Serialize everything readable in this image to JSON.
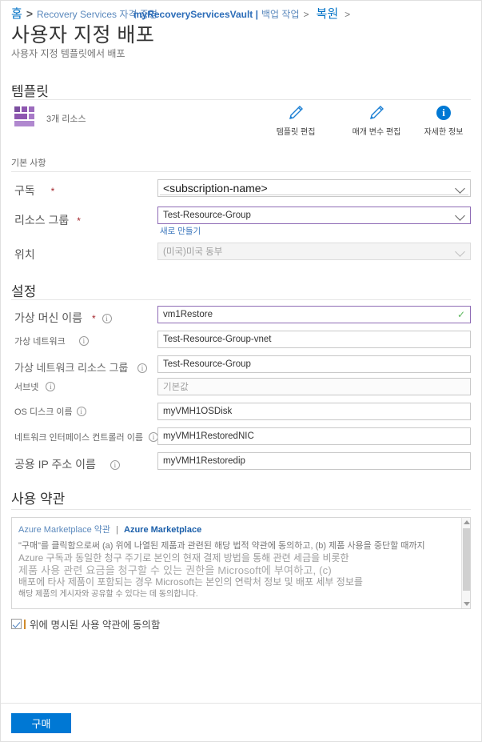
{
  "breadcrumb": {
    "home": "홈",
    "sep": ">",
    "vault_prefix": "Recovery Services 자격 증명",
    "vault_name": "myRecoveryServicesVault |",
    "backup_jobs": "백업 작업",
    "restore": "복원"
  },
  "header": {
    "title": "사용자 지정 배포",
    "subtitle": "사용자 지정 템플릿에서 배포"
  },
  "template": {
    "heading": "템플릿",
    "resource_count": "3개 리소스",
    "actions": [
      {
        "label": "템플릿 편집",
        "icon": "pencil-icon"
      },
      {
        "label": "매개 변수 편집",
        "icon": "pencil-icon"
      },
      {
        "label": "자세한 정보",
        "icon": "info-icon"
      }
    ]
  },
  "basics": {
    "heading": "기본 사항",
    "subscription": {
      "label": "구독",
      "required": "*",
      "value": "<subscription-name>"
    },
    "resource_group": {
      "label": "리소스 그룹",
      "required": "*",
      "value": "Test-Resource-Group",
      "create_new": "새로 만들기"
    },
    "location": {
      "label": "위치",
      "value": "(미국)미국 동부"
    }
  },
  "settings": {
    "heading": "설정",
    "fields": [
      {
        "label": "가상 머신 이름",
        "required": "*",
        "value": "vm1Restore"
      },
      {
        "label": "가상 네트워크",
        "value": "Test-Resource-Group-vnet"
      },
      {
        "label": "가상 네트워크 리소스 그룹",
        "value": "Test-Resource-Group"
      },
      {
        "label": "서브넷",
        "placeholder": "기본값"
      },
      {
        "label": "OS 디스크 이름",
        "value": "myVMH1OSDisk"
      },
      {
        "label": "네트워크 인터페이스 컨트롤러 이름",
        "value": "myVMH1RestoredNIC"
      },
      {
        "label": "공용 IP 주소 이름",
        "value": "myVMH1Restoredip"
      }
    ]
  },
  "terms": {
    "heading": "사용 약관",
    "link_marketplace_terms": "Azure Marketplace 약관",
    "link_separator": "|",
    "link_marketplace": "Azure Marketplace",
    "body_lines": [
      "\"구매\"를 클릭함으로써 (a) 위에 나열된 제품과 관련된 해당 법적 약관에 동의하고, (b) 제품 사용을 중단할 때까지",
      "Azure 구독과 동일한 청구 주기로 본인의 현재 결제 방법을 통해 관련 세금을 비롯한",
      "제품 사용 관련 요금을 청구할 수 있는  권한을 Microsoft에 부여하고, (c)",
      "배포에 타사 제품이 포함되는 경우 Microsoft는 본인의 연락처 정보 및 배포 세부 정보를",
      "해당 제품의 게시자와 공유할 수 있다는 데 동의합니다."
    ],
    "agree_label": "위에 명시된 사용 약관에 동의함"
  },
  "footer": {
    "buy_label": "구매"
  },
  "colors": {
    "accent": "#0078d4",
    "link": "#5b89bd",
    "required": "#a4262c",
    "focus_border": "#8e6bb5",
    "success": "#5db85d",
    "template_icon": "#8e57b0"
  }
}
